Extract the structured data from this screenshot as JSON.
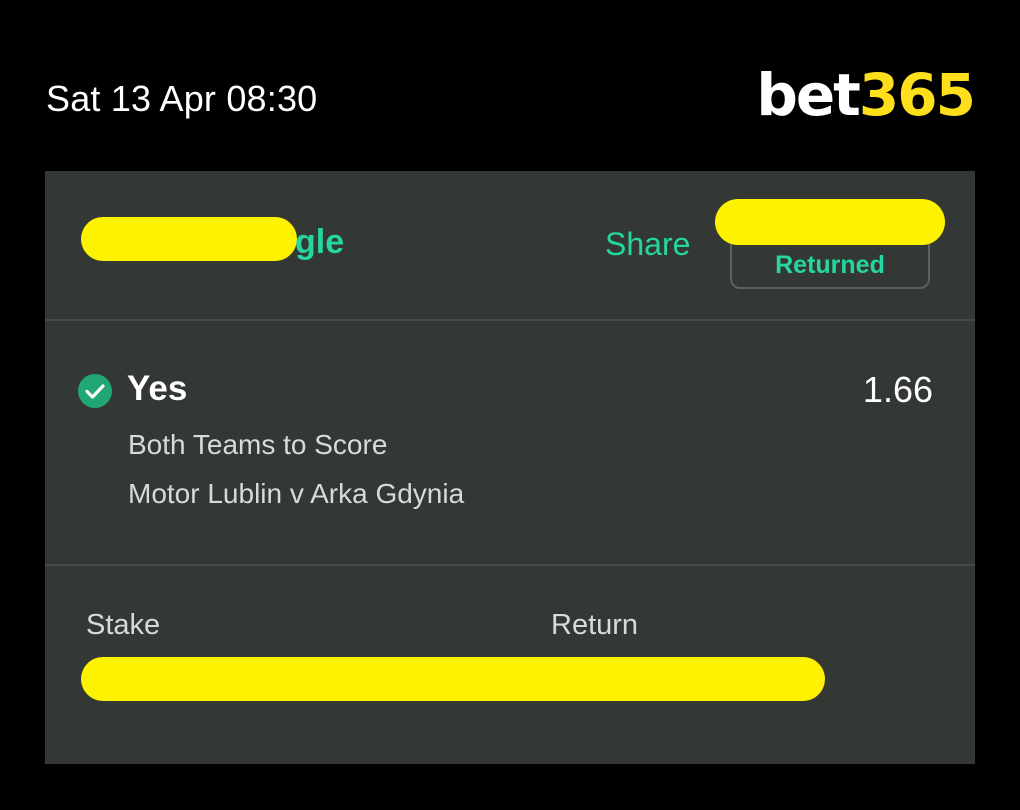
{
  "header": {
    "timestamp": "Sat 13 Apr 08:30",
    "logo_bet": "bet",
    "logo_num": "365"
  },
  "bet": {
    "type_visible": "gle",
    "share_label": "Share",
    "status": "Returned",
    "selection": {
      "name": "Yes",
      "odds": "1.66",
      "market": "Both Teams to Score",
      "event": "Motor Lublin v Arka Gdynia"
    },
    "stake_label": "Stake",
    "return_label": "Return"
  },
  "colors": {
    "background": "#000000",
    "card": "#333835",
    "accent_green": "#25d6a1",
    "check_green": "#20a774",
    "brand_yellow": "#ffdf1b",
    "redaction": "#fff200"
  },
  "icons": {
    "status": "check-circle-icon"
  }
}
